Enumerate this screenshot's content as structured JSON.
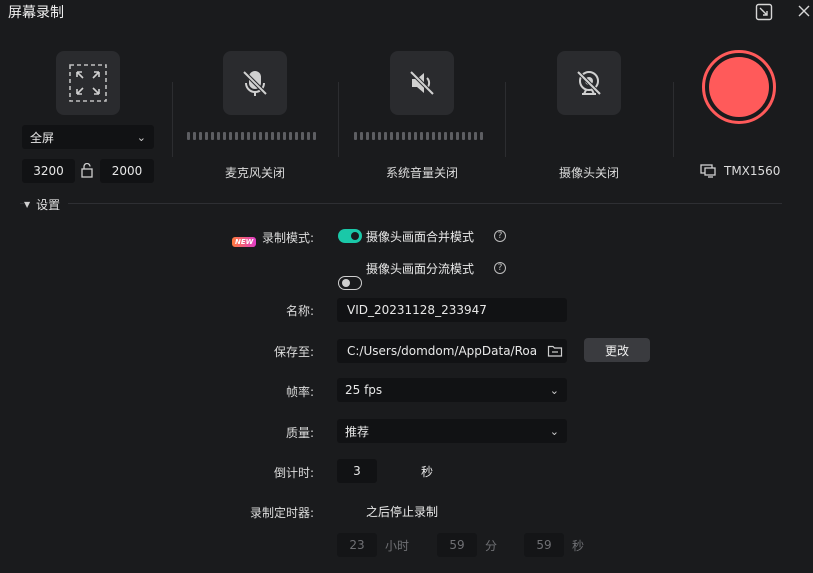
{
  "window": {
    "title": "屏幕录制"
  },
  "titlebar": {
    "icons": [
      "picture-in-picture-icon",
      "close-icon"
    ]
  },
  "capture": {
    "mode": "全屏",
    "width": "3200",
    "height": "2000",
    "link_icon": "lock-aspect-icon"
  },
  "sources": {
    "microphone": {
      "label": "麦克风关闭",
      "icon": "mic-off-icon"
    },
    "system_audio": {
      "label": "系统音量关闭",
      "icon": "speaker-off-icon"
    },
    "camera": {
      "label": "摄像头关闭",
      "icon": "camera-off-icon"
    },
    "display": {
      "label": "TMX1560",
      "icon": "monitor-icon"
    }
  },
  "record_button": {
    "icon": "record-icon",
    "color": "#ff5a5a"
  },
  "settings_section": {
    "label": "设置"
  },
  "form": {
    "badge": "NEW",
    "record_mode": {
      "label": "录制模式:",
      "option1": "摄像头画面合并模式",
      "option1_on": true,
      "option2": "摄像头画面分流模式",
      "option2_on": false
    },
    "name": {
      "label": "名称:",
      "value": "VID_20231128_233947"
    },
    "save_to": {
      "label": "保存至:",
      "value": "C:/Users/domdom/AppData/Roa",
      "change_button": "更改"
    },
    "frame_rate": {
      "label": "帧率:",
      "value": "25 fps"
    },
    "quality": {
      "label": "质量:",
      "value": "推荐"
    },
    "countdown": {
      "label": "倒计时:",
      "value": "3",
      "unit": "秒"
    },
    "timer": {
      "label": "录制定时器:",
      "toggle_label": "之后停止录制",
      "enabled": false,
      "hours": "23",
      "hours_unit": "小时",
      "minutes": "59",
      "minutes_unit": "分",
      "seconds": "59",
      "seconds_unit": "秒"
    }
  },
  "colors": {
    "background": "#1a1b1d",
    "accent_toggle": "#1ac8a8",
    "record": "#ff5a5a"
  }
}
